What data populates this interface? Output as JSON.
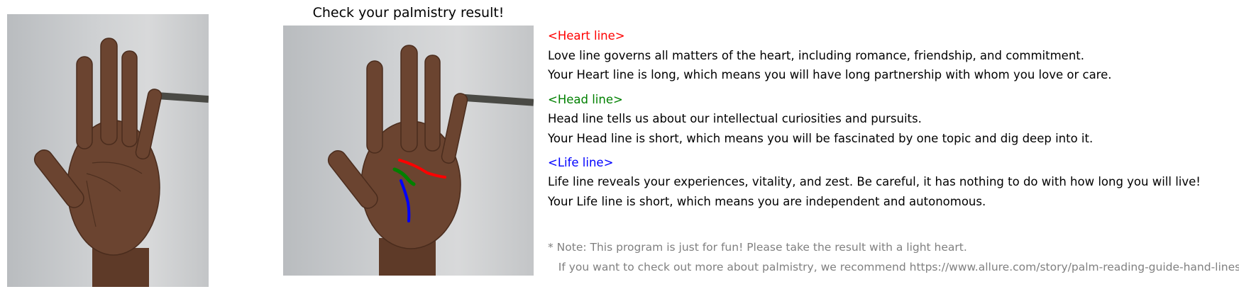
{
  "result_title": "Check your palmistry result!",
  "sections": [
    {
      "heading": "<Heart line>",
      "color": "#ff0000",
      "lines": [
        "Love line governs all matters of the heart, including romance, friendship, and commitment.",
        "Your Heart line is long, which means you will have long partnership with whom you love or care."
      ]
    },
    {
      "heading": "<Head line>",
      "color": "#008000",
      "lines": [
        "Head line tells us about our intellectual curiosities and pursuits.",
        "Your Head line is short, which means you will be fascinated by one topic and dig deep into it."
      ]
    },
    {
      "heading": "<Life line>",
      "color": "#0000ff",
      "lines": [
        "Life line reveals your experiences, vitality, and zest. Be careful, it has nothing to do with how long you will live!",
        "Your Life line is short, which means you are independent and autonomous."
      ]
    }
  ],
  "note": [
    "* Note: This program is just for fun! Please take the result with a light heart.",
    "   If you want to check out more about palmistry, we recommend https://www.allure.com/story/palm-reading-guide-hand-lines"
  ],
  "colors": {
    "heart": "#ff0000",
    "head": "#008000",
    "life": "#0000ff",
    "note": "#808080"
  }
}
